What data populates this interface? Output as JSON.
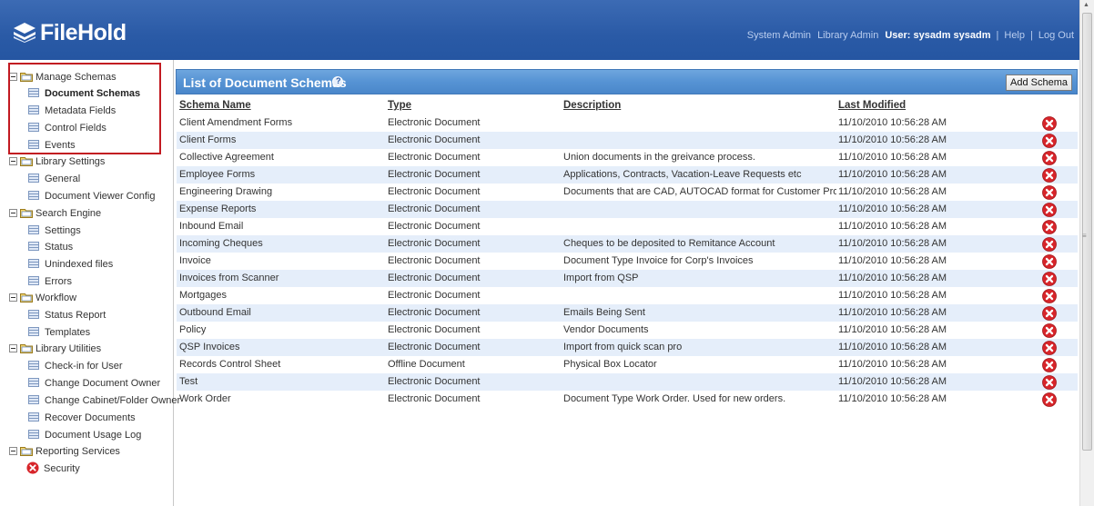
{
  "app": {
    "logo_text": "FileHold"
  },
  "topnav": {
    "system_admin": "System Admin",
    "library_admin": "Library Admin",
    "user": "User: sysadm sysadm",
    "sep": "|",
    "help": "Help",
    "logout": "Log Out"
  },
  "sidebar": {
    "groups": [
      {
        "label": "Manage Schemas",
        "items": [
          "Document Schemas",
          "Metadata Fields",
          "Control Fields",
          "Events"
        ]
      },
      {
        "label": "Library Settings",
        "items": [
          "General",
          "Document Viewer Config"
        ]
      },
      {
        "label": "Search Engine",
        "items": [
          "Settings",
          "Status",
          "Unindexed files",
          "Errors"
        ]
      },
      {
        "label": "Workflow",
        "items": [
          "Status Report",
          "Templates"
        ]
      },
      {
        "label": "Library Utilities",
        "items": [
          "Check-in for User",
          "Change Document Owner",
          "Change Cabinet/Folder Owner",
          "Recover Documents",
          "Document Usage Log"
        ]
      },
      {
        "label": "Reporting Services",
        "items": [
          "Security"
        ]
      }
    ],
    "active_item": "Document Schemas"
  },
  "panel": {
    "title": "List of Document Schemas",
    "add_button": "Add Schema"
  },
  "table": {
    "columns": [
      "Schema Name",
      "Type",
      "Description",
      "Last Modified"
    ],
    "rows": [
      [
        "Client Amendment Forms",
        "Electronic Document",
        "",
        "11/10/2010 10:56:28 AM"
      ],
      [
        "Client Forms",
        "Electronic Document",
        "",
        "11/10/2010 10:56:28 AM"
      ],
      [
        "Collective Agreement",
        "Electronic Document",
        "Union documents in the greivance process.",
        "11/10/2010 10:56:28 AM"
      ],
      [
        "Employee Forms",
        "Electronic Document",
        "Applications, Contracts, Vacation-Leave Requests etc",
        "11/10/2010 10:56:28 AM"
      ],
      [
        "Engineering Drawing",
        "Electronic Document",
        "Documents that are CAD, AUTOCAD format for Customer Projects",
        "11/10/2010 10:56:28 AM"
      ],
      [
        "Expense Reports",
        "Electronic Document",
        "",
        "11/10/2010 10:56:28 AM"
      ],
      [
        "Inbound Email",
        "Electronic Document",
        "",
        "11/10/2010 10:56:28 AM"
      ],
      [
        "Incoming Cheques",
        "Electronic Document",
        "Cheques to be deposited to Remitance Account",
        "11/10/2010 10:56:28 AM"
      ],
      [
        "Invoice",
        "Electronic Document",
        "Document Type Invoice for Corp's Invoices",
        "11/10/2010 10:56:28 AM"
      ],
      [
        "Invoices from Scanner",
        "Electronic Document",
        "Import from QSP",
        "11/10/2010 10:56:28 AM"
      ],
      [
        "Mortgages",
        "Electronic Document",
        "",
        "11/10/2010 10:56:28 AM"
      ],
      [
        "Outbound Email",
        "Electronic Document",
        "Emails Being Sent",
        "11/10/2010 10:56:28 AM"
      ],
      [
        "Policy",
        "Electronic Document",
        "Vendor Documents",
        "11/10/2010 10:56:28 AM"
      ],
      [
        "QSP Invoices",
        "Electronic Document",
        "Import from quick scan pro",
        "11/10/2010 10:56:28 AM"
      ],
      [
        "Records Control Sheet",
        "Offline Document",
        "Physical Box Locator",
        "11/10/2010 10:56:28 AM"
      ],
      [
        "Test",
        "Electronic Document",
        "",
        "11/10/2010 10:56:28 AM"
      ],
      [
        "Work Order",
        "Electronic Document",
        "Document Type Work Order. Used for new orders.",
        "11/10/2010 10:56:28 AM"
      ]
    ]
  },
  "colors": {
    "header_bg": "#2a5aa6",
    "panel_title_bg": "#5693d4",
    "row_alt_bg": "#e5eefa",
    "delete_red": "#d7252a",
    "highlight_border": "#c21a21"
  },
  "icons": {
    "logo": "filehold-logo-icon",
    "folder": "folder-icon",
    "page": "page-icon",
    "delete": "delete-x-icon",
    "help": "help-icon"
  }
}
